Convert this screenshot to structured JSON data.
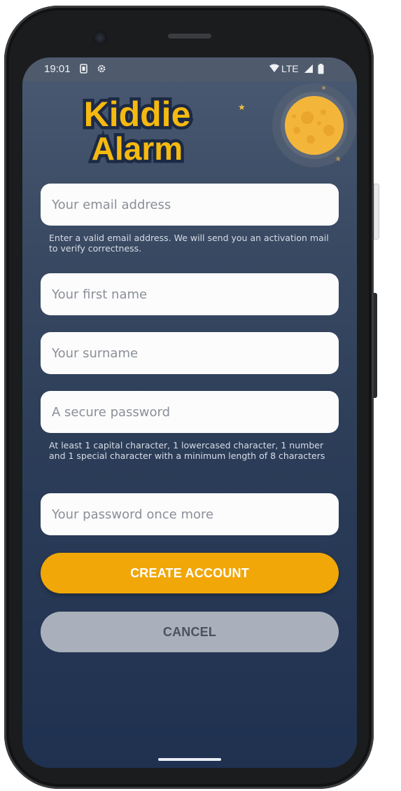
{
  "status_bar": {
    "time": "19:01",
    "network": "LTE",
    "icons": [
      "sim-card-icon",
      "gear-icon",
      "wifi-icon",
      "signal-icon",
      "battery-icon"
    ]
  },
  "logo": {
    "line1": "Kiddie",
    "line2": "Alarm"
  },
  "form": {
    "email_placeholder": "Your email address",
    "email_hint": "Enter a valid email address. We will send you an activation mail to verify correctness.",
    "first_name_placeholder": "Your first name",
    "surname_placeholder": "Your surname",
    "password_placeholder": "A secure password",
    "password_hint": "At least 1 capital character, 1 lowercased character, 1 number and 1 special character with a minimum length of 8 characters",
    "password_confirm_placeholder": "Your password once more"
  },
  "buttons": {
    "create_account": "CREATE ACCOUNT",
    "cancel": "CANCEL"
  },
  "colors": {
    "accent": "#f1a707",
    "background_top": "#4a5a73",
    "background_bottom": "#1f3150",
    "cancel_button": "#a9b0bb"
  }
}
